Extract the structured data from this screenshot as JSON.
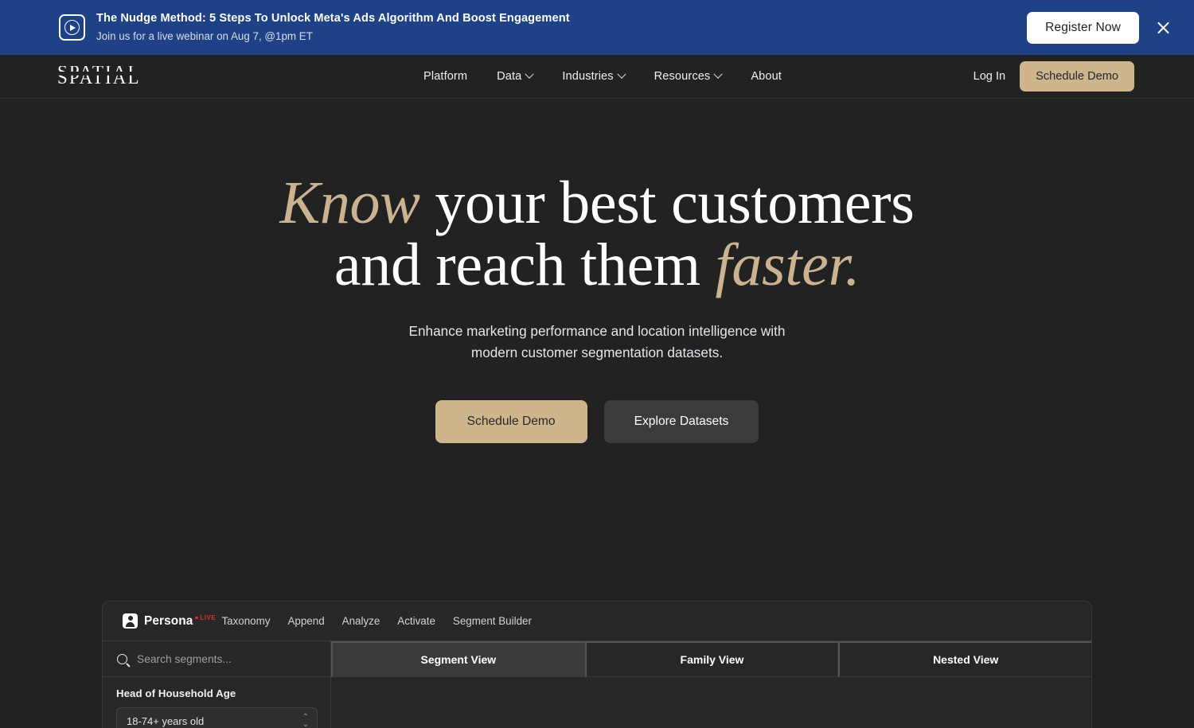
{
  "banner": {
    "icon": "video-play-icon",
    "title": "The Nudge Method: 5 Steps To Unlock Meta's Ads Algorithm And Boost Engagement",
    "subtitle": "Join us for a live webinar on Aug 7, @1pm ET",
    "register_label": "Register Now",
    "close_icon": "close-icon",
    "background_color": "#1e4285"
  },
  "nav": {
    "logo_text": "SPATIAL",
    "links": [
      {
        "label": "Platform",
        "has_dropdown": false
      },
      {
        "label": "Data",
        "has_dropdown": true
      },
      {
        "label": "Industries",
        "has_dropdown": true
      },
      {
        "label": "Resources",
        "has_dropdown": true
      },
      {
        "label": "About",
        "has_dropdown": false
      }
    ],
    "login_label": "Log In",
    "schedule_demo_label": "Schedule Demo",
    "accent_color": "#cfb58c"
  },
  "hero": {
    "headline_word_1": "Know",
    "headline_mid_1": " your best customers",
    "headline_mid_2": "and reach them ",
    "headline_word_2": "faster.",
    "subtext_line_1": "Enhance marketing performance and location intelligence with",
    "subtext_line_2": "modern customer segmentation datasets.",
    "primary_cta": "Schedule Demo",
    "secondary_cta": "Explore Datasets",
    "accent_color": "#cbb391"
  },
  "app_preview": {
    "brand_name": "Persona",
    "brand_icon": "persona-avatar-icon",
    "live_badge": "LIVE",
    "live_badge_color": "#d9342b",
    "nav_items": [
      "Taxonomy",
      "Append",
      "Analyze",
      "Activate",
      "Segment Builder"
    ],
    "search_placeholder": "Search segments...",
    "search_value": "",
    "filter_label": "Head of Household Age",
    "filter_value": "18-74+ years old",
    "tabs": [
      {
        "label": "Segment View",
        "active": true
      },
      {
        "label": "Family View",
        "active": false
      },
      {
        "label": "Nested View",
        "active": false
      }
    ]
  }
}
